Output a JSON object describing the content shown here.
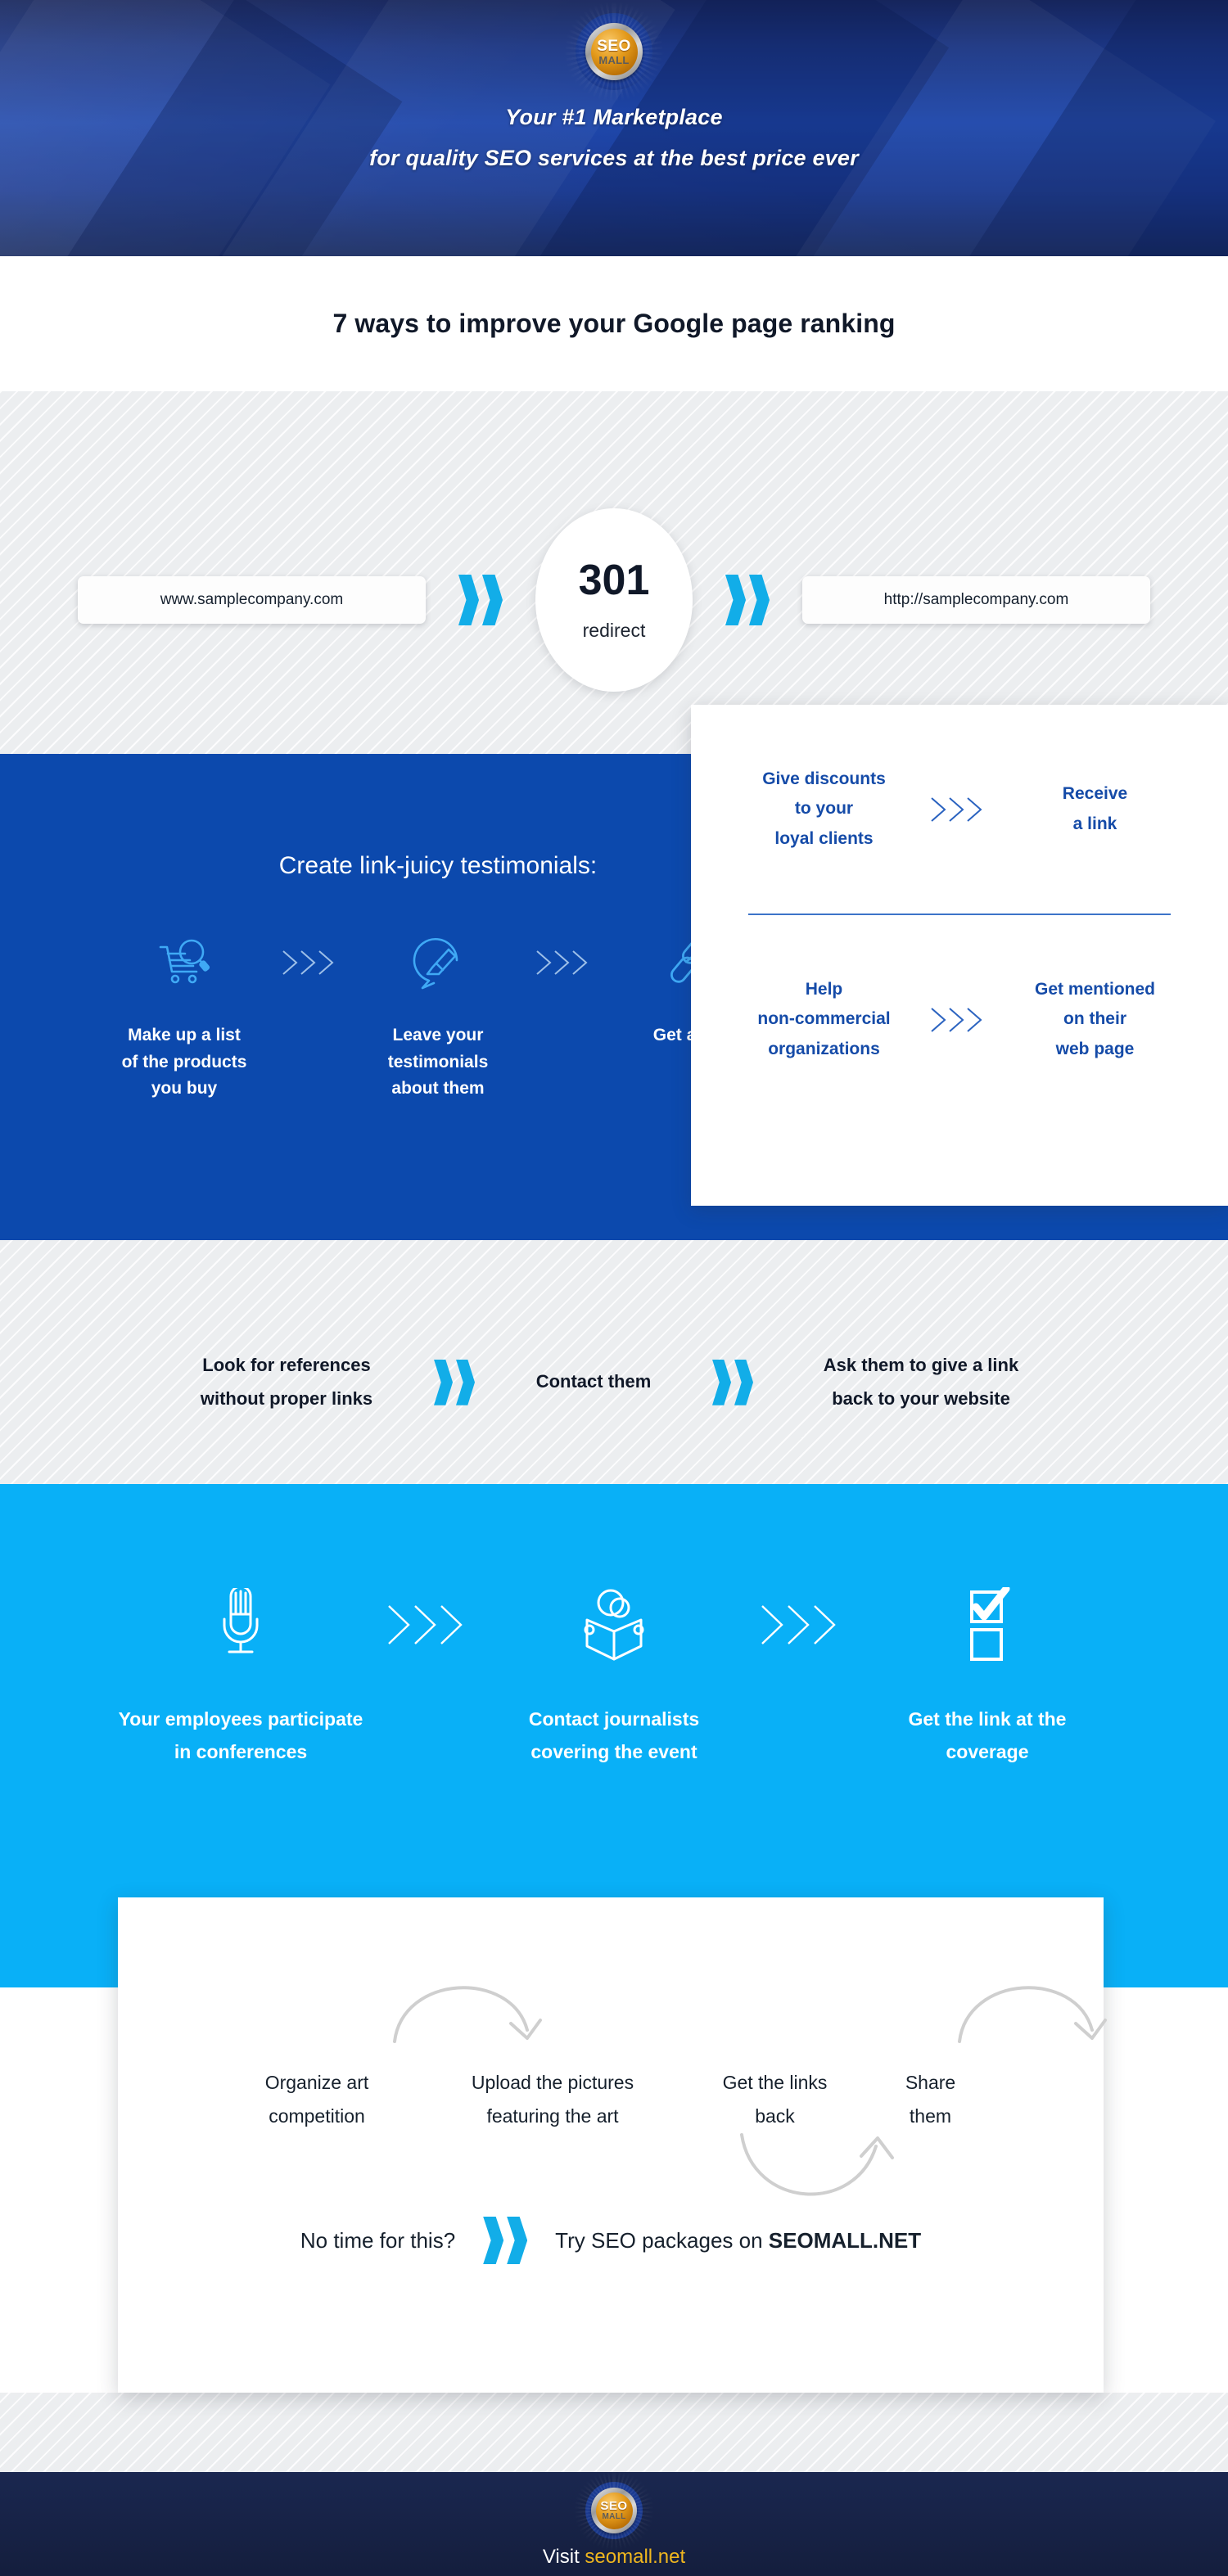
{
  "brand": {
    "logo_top": "SEO",
    "logo_bottom": "MALL",
    "accent_blue": "#0c49ad",
    "accent_cyan": "#09b0f7",
    "accent_gold": "#efb61f",
    "navy": "#16255c"
  },
  "header": {
    "tagline_line1": "Your #1 Marketplace",
    "tagline_line2": "for quality SEO services at the best price ever"
  },
  "title": "7 ways to improve your Google page ranking",
  "redirect": {
    "source_url": "www.samplecompany.com",
    "code": "301",
    "code_label": "redirect",
    "target_url": "http://samplecompany.com"
  },
  "testimonials": {
    "heading": "Create link-juicy testimonials:",
    "steps": [
      {
        "icon": "cart-search-icon",
        "label": "Make up a list\nof the products\nyou buy"
      },
      {
        "icon": "speech-pencil-icon",
        "label": "Leave your\ntestimonials\nabout them"
      },
      {
        "icon": "link-plus-icon",
        "label": "Get a link"
      }
    ]
  },
  "discount_card": {
    "rows": [
      {
        "from": "Give discounts\nto your\nloyal clients",
        "to": "Receive\na link"
      },
      {
        "from": "Help\nnon-commercial\norganizations",
        "to": "Get mentioned\non their\nweb page"
      }
    ]
  },
  "references": {
    "step1": "Look for references\nwithout proper links",
    "step2": "Contact them",
    "step3": "Ask them to give a link\nback to your website"
  },
  "conferences": {
    "steps": [
      {
        "icon": "microphone-icon",
        "label": "Your employees participate\nin conferences"
      },
      {
        "icon": "journalist-reading-icon",
        "label": "Contact journalists\ncovering the event"
      },
      {
        "icon": "checklist-icon",
        "label": "Get the link at the\ncoverage"
      }
    ]
  },
  "art_competition": {
    "cols": [
      "Organize art\ncompetition",
      "Upload the pictures\nfeaturing the art",
      "Get the links\nback",
      "Share\nthem"
    ]
  },
  "cta": {
    "question": "No time for this?",
    "answer_prefix": "Try SEO packages on ",
    "answer_brand": "SEOMALL.NET"
  },
  "footer": {
    "visit_prefix": "Visit ",
    "visit_domain": "seomall.net"
  }
}
